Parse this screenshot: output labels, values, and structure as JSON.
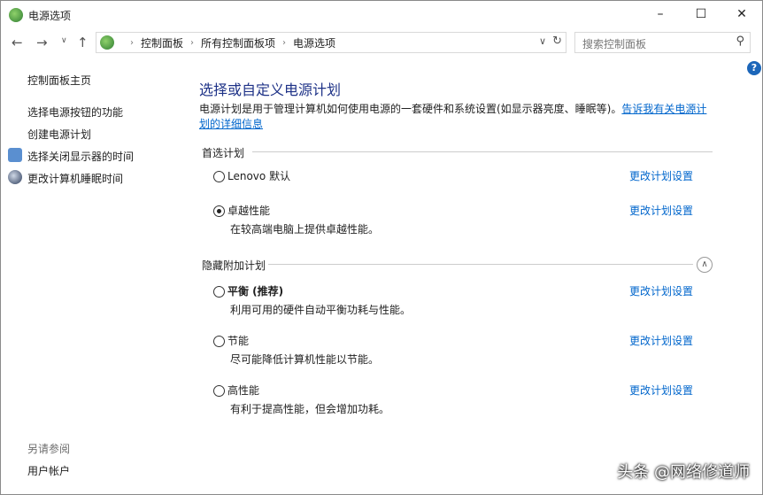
{
  "window": {
    "title": "电源选项"
  },
  "address": {
    "crumbs": [
      "控制面板",
      "所有控制面板项",
      "电源选项"
    ]
  },
  "search": {
    "placeholder": "搜索控制面板"
  },
  "sidebar": {
    "home": "控制面板主页",
    "items": [
      "选择电源按钮的功能",
      "创建电源计划",
      "选择关闭显示器的时间",
      "更改计算机睡眠时间"
    ],
    "see_also": "另请参阅",
    "user_accounts": "用户帐户"
  },
  "main": {
    "title": "选择或自定义电源计划",
    "description": "电源计划是用于管理计算机如何使用电源的一套硬件和系统设置(如显示器亮度、睡眠等)。",
    "link": "告诉我有关电源计划的详细信息",
    "preferred_label": "首选计划",
    "hidden_label": "隐藏附加计划",
    "change_label": "更改计划设置",
    "plans": [
      {
        "name": "Lenovo 默认",
        "desc": "",
        "selected": false
      },
      {
        "name": "卓越性能",
        "desc": "在较高端电脑上提供卓越性能。",
        "selected": true
      },
      {
        "name": "平衡 (推荐)",
        "desc": "利用可用的硬件自动平衡功耗与性能。",
        "selected": false
      },
      {
        "name": "节能",
        "desc": "尽可能降低计算机性能以节能。",
        "selected": false
      },
      {
        "name": "高性能",
        "desc": "有利于提高性能，但会增加功耗。",
        "selected": false
      }
    ]
  },
  "watermark": "头条 @网络修道师"
}
